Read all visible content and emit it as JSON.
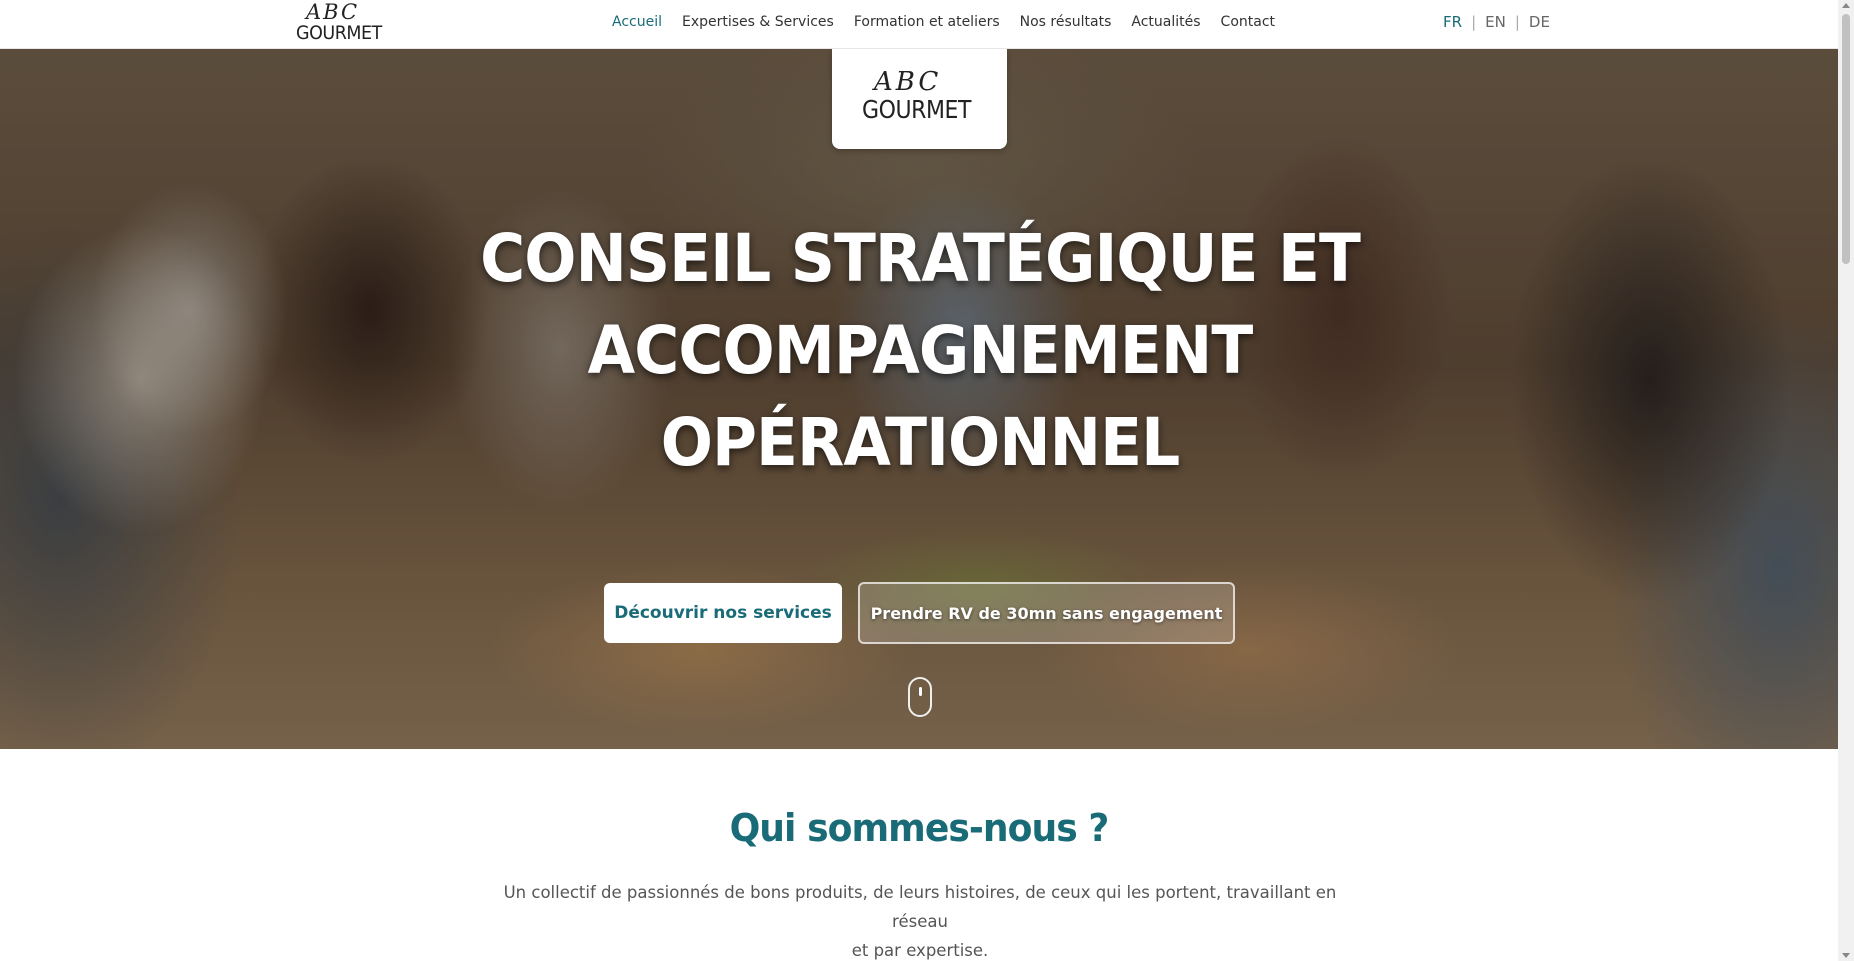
{
  "brand": {
    "logo_script": "ABC",
    "logo_word": "GOURMET"
  },
  "nav": {
    "items": [
      {
        "label": "Accueil",
        "active": true
      },
      {
        "label": "Expertises & Services",
        "active": false
      },
      {
        "label": "Formation et ateliers",
        "active": false
      },
      {
        "label": "Nos résultats",
        "active": false
      },
      {
        "label": "Actualités",
        "active": false
      },
      {
        "label": "Contact",
        "active": false
      }
    ]
  },
  "languages": [
    {
      "code": "FR",
      "active": true
    },
    {
      "code": "EN",
      "active": false
    },
    {
      "code": "DE",
      "active": false
    }
  ],
  "language_separator": "|",
  "hero": {
    "title_lines": [
      "CONSEIL STRATÉGIQUE ET",
      "ACCOMPAGNEMENT",
      "OPÉRATIONNEL"
    ],
    "primary_button": "Découvrir nos services",
    "secondary_button": "Prendre RV de 30mn sans engagement"
  },
  "about": {
    "title": "Qui sommes-nous ?",
    "text_line1": "Un collectif de passionnés de bons produits, de leurs histoires, de ceux qui les portent, travaillant en réseau",
    "text_line2": "et par expertise."
  },
  "colors": {
    "accent": "#1a6b78",
    "white": "#ffffff"
  }
}
